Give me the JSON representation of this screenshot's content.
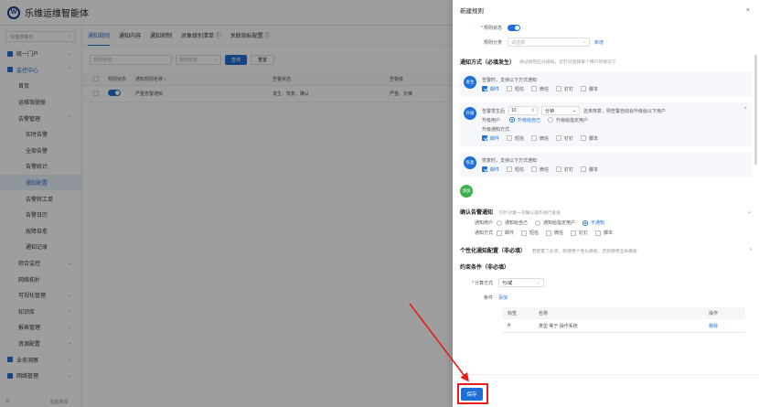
{
  "app": {
    "title": "乐维运维智能体",
    "logo_letter": "W"
  },
  "sidebar": {
    "search_placeholder": "快速搜菜单",
    "items": [
      {
        "label": "统一门户",
        "level": 1,
        "caret": "⌄",
        "icon_color": "#1f6fd6"
      },
      {
        "label": "监控中心",
        "level": 1,
        "caret": "⌃",
        "icon_color": "#1f6fd6",
        "top_active": true
      },
      {
        "label": "首页",
        "level": 2
      },
      {
        "label": "运维驾驶舱",
        "level": 2
      },
      {
        "label": "告警管理",
        "level": 2,
        "caret": "⌃"
      },
      {
        "label": "实时告警",
        "level": 3
      },
      {
        "label": "全部告警",
        "level": 3
      },
      {
        "label": "告警统计",
        "level": 3
      },
      {
        "label": "通知配置",
        "level": 3,
        "active": true
      },
      {
        "label": "告警转工单",
        "level": 3
      },
      {
        "label": "告警日历",
        "level": 3
      },
      {
        "label": "故障自愈",
        "level": 3
      },
      {
        "label": "通知记录",
        "level": 3
      },
      {
        "label": "综合监控",
        "level": 2,
        "caret": "⌄"
      },
      {
        "label": "网络拓扑",
        "level": 2
      },
      {
        "label": "可视化管理",
        "level": 2,
        "caret": "⌄"
      },
      {
        "label": "知识库",
        "level": 2,
        "caret": "⌄"
      },
      {
        "label": "报表管理",
        "level": 2,
        "caret": "⌄"
      },
      {
        "label": "资源配置",
        "level": 2,
        "caret": "⌄"
      },
      {
        "label": "业务洞察",
        "level": 1,
        "caret": "⌄",
        "icon_color": "#1f6fd6"
      },
      {
        "label": "网络管理",
        "level": 1,
        "caret": "⌄",
        "icon_color": "#1f6fd6"
      }
    ],
    "bottom_label": "收起菜单"
  },
  "main": {
    "tabs": [
      "通知规则",
      "通知内容",
      "通知抑制",
      "对象级别清单 ⓘ",
      "关联指标配置 ⓘ"
    ],
    "filter_input_placeholder": "规则名称",
    "filter_select_placeholder": "规则状态",
    "search_button": "查询",
    "reset_button": "重置",
    "table_headers": [
      "规则状态",
      "通知规则名称 ↕",
      "告警状态",
      "告警级"
    ],
    "rows": [
      {
        "name": "严重告警通知",
        "status": "发生、恢复、确认",
        "level": "严重、灾难"
      }
    ]
  },
  "drawer": {
    "title": "新建规则",
    "close_icon": "×",
    "rule_status_label": "规则状态",
    "rule_category_label": "规则分类",
    "rule_category_placeholder": "请选择",
    "new_link": "新增",
    "notify_section_title": "通知方式（必填发生）",
    "notify_section_hint": "通过颜色区分通知，仅针对选择单个用户的情况下",
    "channels": [
      "邮件",
      "短信",
      "微信",
      "钉钉",
      "脚本"
    ],
    "cards": [
      {
        "badge": "发生",
        "badge_color": "#1f6fd6",
        "desc": "告警时，支持以下方式通知",
        "checked": [
          true,
          false,
          false,
          false,
          false
        ]
      },
      {
        "badge": "升级",
        "badge_color": "#1f6fd6",
        "desc_prefix": "告警发生后",
        "num_value": "10",
        "unit": "分钟",
        "desc_suffix": "还未恢复，则告警自动会升级给以下用户",
        "escalate_users_label": "升级用户",
        "opt_self": "升级给自己",
        "opt_specified": "升级给指定用户",
        "escalate_method_label": "升级通知方式",
        "checked": [
          true,
          false,
          false,
          false,
          false
        ]
      },
      {
        "badge": "恢复",
        "badge_color": "#1f6fd6",
        "desc": "恢复时，支持以下方式通知",
        "checked": [
          true,
          false,
          false,
          false,
          false
        ]
      },
      {
        "badge": "添加",
        "badge_color": "#3bb34a"
      }
    ],
    "confirm_title": "确认告警通知",
    "confirm_hint": "仅针对第一次确认操作进行发送",
    "notify_users_label": "通知用户",
    "notify_user_options": [
      "通知给自己",
      "通知给指定用户",
      "不通知"
    ],
    "notify_user_selected": 2,
    "notify_method_label": "通知方式",
    "personal_title": "个性化通知配置（非必填）",
    "personal_hint": "若配置了此项，则使用个性化模板，否则使用全局模板",
    "constraint_title": "约束条件（非必填）",
    "calc_label": "计算方式",
    "calc_value": "与/或",
    "condition_label": "条件",
    "add_link": "添加",
    "cond_table_headers": [
      "标签",
      "名称",
      "操作"
    ],
    "cond_rows": [
      {
        "tag": "A",
        "name": "类型 等于 操作系统",
        "action": "移除"
      }
    ],
    "save_button": "保存"
  },
  "annotation": {
    "color": "#e3201b"
  }
}
